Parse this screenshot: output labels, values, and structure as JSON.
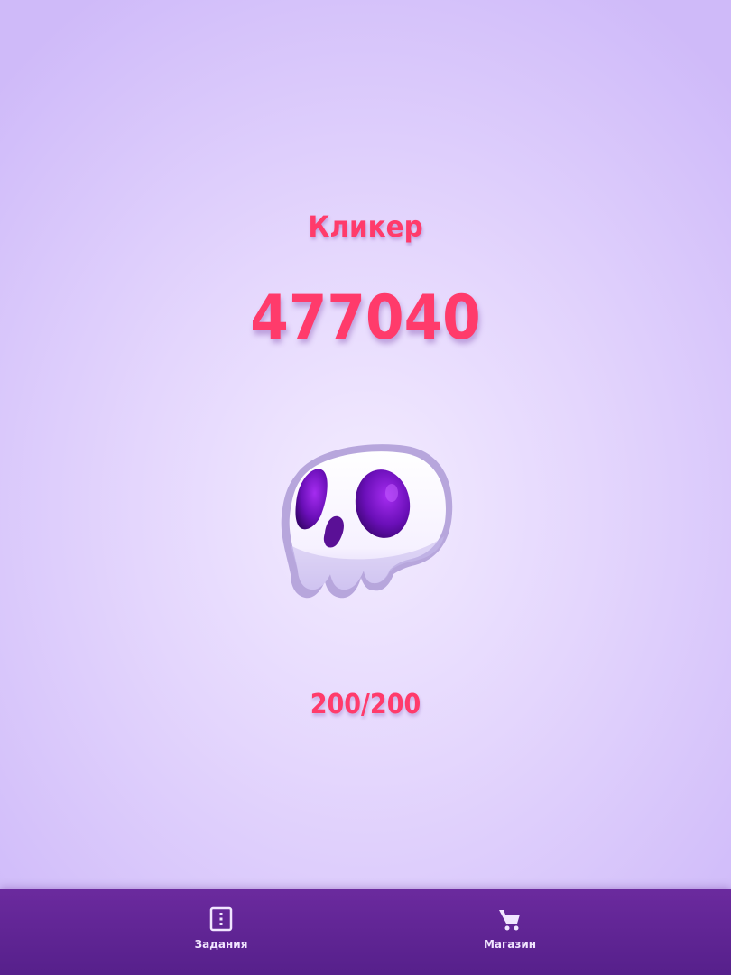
{
  "game": {
    "title": "Кликер",
    "score": "477040",
    "energy": "200/200"
  },
  "navbar": {
    "items": [
      {
        "label": "Задания",
        "icon": "tasks-icon"
      },
      {
        "label": "Магазин",
        "icon": "cart-icon"
      }
    ]
  },
  "colors": {
    "accent": "#ff3b6b",
    "navbar": "#5e248f",
    "background": "#e4d6fd",
    "skull_eye": "#6a0fb8"
  }
}
